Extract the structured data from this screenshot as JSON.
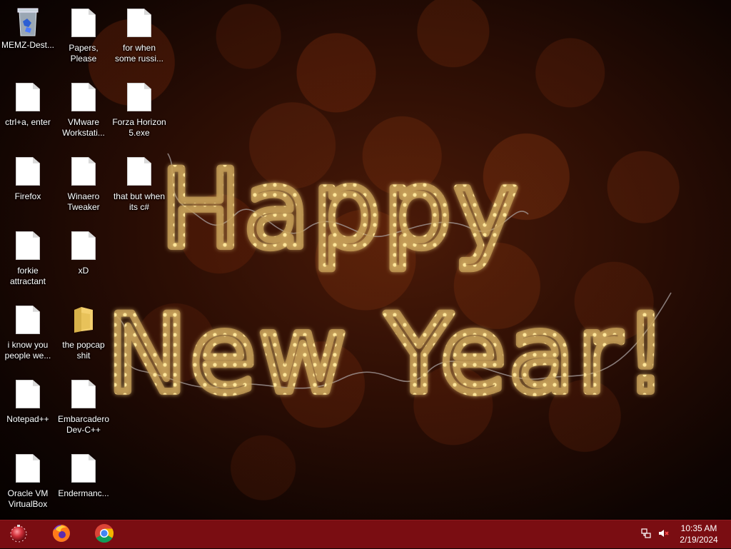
{
  "wallpaper": {
    "line1": "Happy",
    "line2": "New Year!",
    "colors": {
      "bulb": "#ffe79a",
      "tube": "#c9a25a",
      "wire": "#a8a0a0"
    }
  },
  "desktop_icons": [
    {
      "id": "memz",
      "label": "MEMZ-Dest...",
      "icon": "recycle-bin-icon"
    },
    {
      "id": "papers",
      "label": "Papers, Please",
      "icon": "file-icon"
    },
    {
      "id": "forwhen",
      "label": "for when some russi...",
      "icon": "file-icon"
    },
    {
      "id": "ctrla",
      "label": "ctrl+a, enter",
      "icon": "file-icon"
    },
    {
      "id": "vmware",
      "label": "VMware Workstati...",
      "icon": "file-icon"
    },
    {
      "id": "forza",
      "label": "Forza Horizon 5.exe",
      "icon": "file-icon"
    },
    {
      "id": "firefox",
      "label": "Firefox",
      "icon": "file-icon"
    },
    {
      "id": "winaero",
      "label": "Winaero Tweaker",
      "icon": "file-icon"
    },
    {
      "id": "thatbut",
      "label": "that but when its c#",
      "icon": "file-icon"
    },
    {
      "id": "forkie",
      "label": "forkie attractant",
      "icon": "file-icon"
    },
    {
      "id": "xd",
      "label": "xD",
      "icon": "file-icon"
    },
    {
      "id": "iknow",
      "label": "i know you people we...",
      "icon": "file-icon"
    },
    {
      "id": "popcap",
      "label": "the popcap shit",
      "icon": "folder-icon"
    },
    {
      "id": "notepadpp",
      "label": "Notepad++",
      "icon": "file-icon"
    },
    {
      "id": "devcpp",
      "label": "Embarcadero Dev-C++",
      "icon": "file-icon"
    },
    {
      "id": "virtualbox",
      "label": "Oracle VM VirtualBox",
      "icon": "file-icon"
    },
    {
      "id": "endermanch",
      "label": "Endermanc...",
      "icon": "file-icon"
    }
  ],
  "taskbar": {
    "background": "#7a0d12",
    "pinned": [
      {
        "name": "start",
        "icon": "start-orb-icon"
      },
      {
        "name": "firefox",
        "icon": "firefox-icon"
      },
      {
        "name": "chrome",
        "icon": "chrome-icon"
      }
    ],
    "tray": {
      "network_icon": "network-icon",
      "volume_icon": "volume-muted-icon",
      "time": "10:35 AM",
      "date": "2/19/2024"
    }
  }
}
